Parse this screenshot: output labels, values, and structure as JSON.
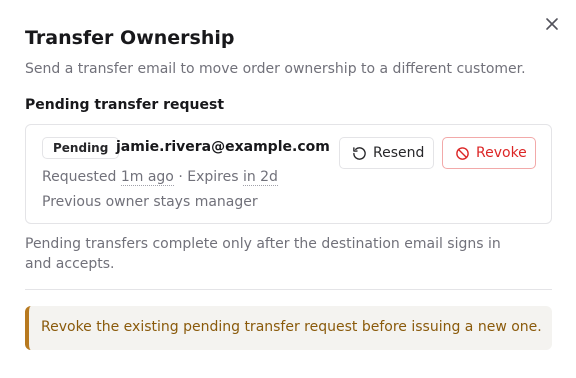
{
  "dialog": {
    "title": "Transfer Ownership",
    "subtitle": "Send a transfer email to move order ownership to a different customer.",
    "close_icon": "close-icon"
  },
  "pending": {
    "heading": "Pending transfer request",
    "status_badge": "Pending",
    "email": "jamie.rivera@example.com",
    "requested_label": "Requested",
    "requested_value": "1m ago",
    "separator": "·",
    "expires_label": "Expires",
    "expires_value": "in 2d",
    "note": "Previous owner stays manager",
    "resend_label": "Resend",
    "resend_icon": "rotate-ccw-icon",
    "revoke_label": "Revoke",
    "revoke_icon": "ban-icon"
  },
  "helper_text": "Pending transfers complete only after the destination email signs in and accepts.",
  "warning": {
    "text": "Revoke the existing pending transfer request before issuing a new one."
  },
  "colors": {
    "revoke": "#dc2626",
    "warning_accent": "#b7791f",
    "warning_text": "#8a5a0b",
    "warning_bg": "#f4f3f0"
  }
}
